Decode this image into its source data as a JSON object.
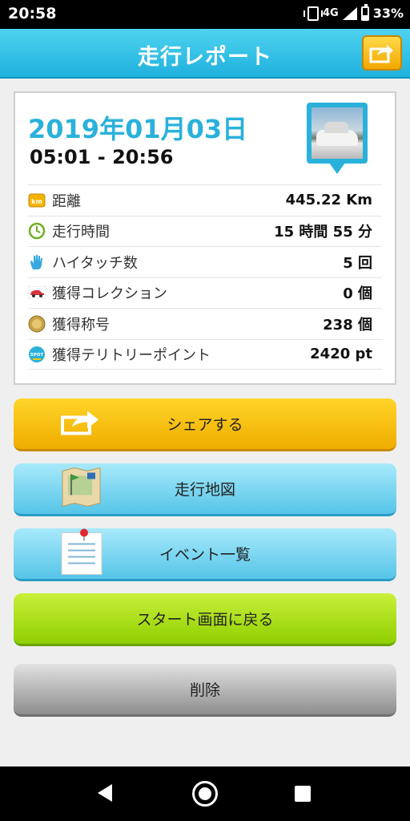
{
  "status_bar": {
    "time": "20:58",
    "network": "4G",
    "battery": "33%"
  },
  "header": {
    "title": "走行レポート"
  },
  "report": {
    "date": "2019年01月03日",
    "time_range": "05:01 - 20:56",
    "stats": [
      {
        "icon": "km-icon",
        "label": "距離",
        "value": "445.22 Km"
      },
      {
        "icon": "clock-icon",
        "label": "走行時間",
        "value": "15 時間 55 分"
      },
      {
        "icon": "hand-icon",
        "label": "ハイタッチ数",
        "value": "5 回"
      },
      {
        "icon": "car-icon",
        "label": "獲得コレクション",
        "value": "0 個"
      },
      {
        "icon": "medal-icon",
        "label": "獲得称号",
        "value": "238 個"
      },
      {
        "icon": "spot-icon",
        "label": "獲得テリトリーポイント",
        "value": "2420 pt"
      }
    ],
    "km_badge": "km",
    "spot_badge": "SPOT"
  },
  "buttons": {
    "share": "シェアする",
    "map": "走行地図",
    "events": "イベント一覧",
    "back_to_start": "スタート画面に戻る",
    "delete": "削除"
  },
  "colors": {
    "header": "#2ab1db",
    "share": "#f5c000",
    "map": "#7ad6f2",
    "start": "#a8e01a",
    "delete": "#b5b5b5"
  }
}
